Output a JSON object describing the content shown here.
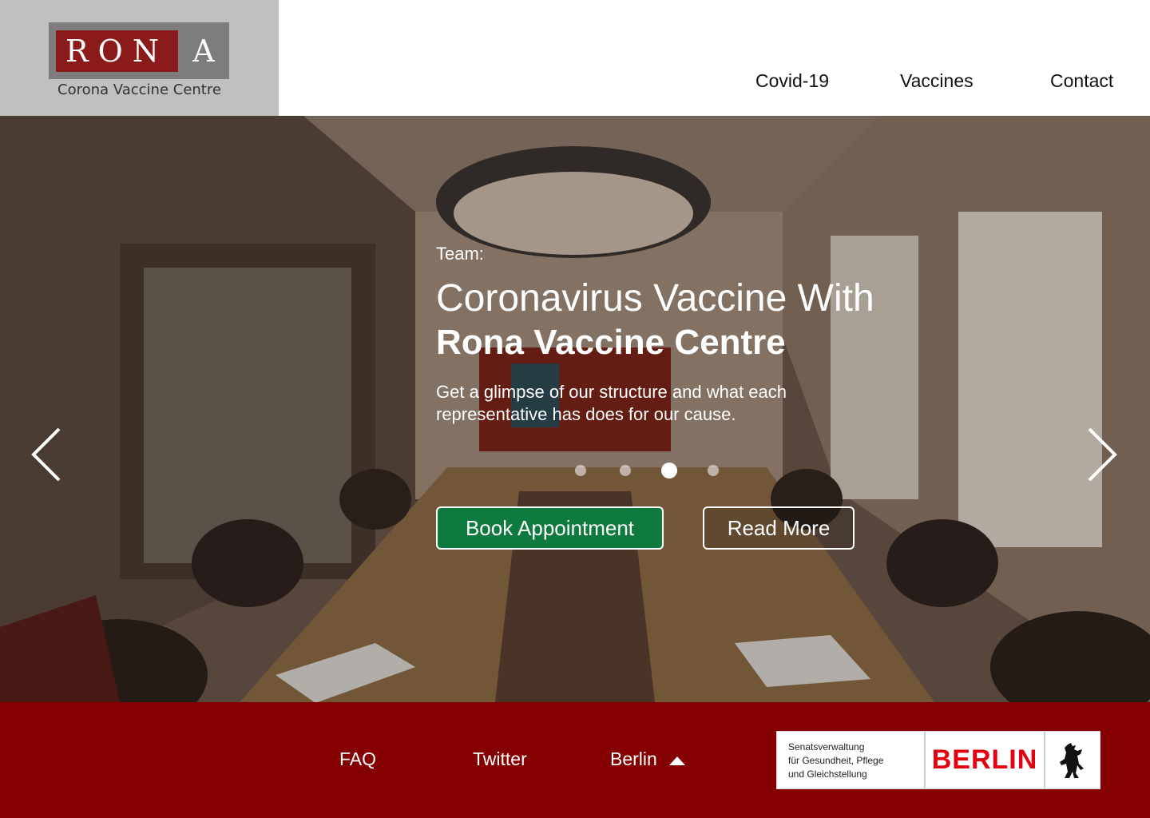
{
  "logo": {
    "letters_boxed": "RON",
    "letter_plain": "A",
    "subtitle": "Corona Vaccine Centre"
  },
  "nav": {
    "items": [
      "Covid-19",
      "Vaccines",
      "Contact"
    ]
  },
  "hero": {
    "eyebrow": "Team:",
    "headline_light": "Coronavirus Vaccine With",
    "headline_bold": "Rona Vaccine Centre",
    "description": "Get a glimpse of our structure and what each representative has does for our cause.",
    "primary_button": "Book Appointment",
    "secondary_button": "Read More",
    "carousel": {
      "slide_count": 4,
      "active_index": 2
    }
  },
  "footer": {
    "links": [
      "FAQ",
      "Twitter",
      "Berlin"
    ],
    "badge": {
      "text_line1": "Senatsverwaltung",
      "text_line2": "für Gesundheit, Pflege",
      "text_line3": "und Gleichstellung",
      "city": "BERLIN"
    }
  },
  "colors": {
    "brand_red": "#8b1a1a",
    "footer_red": "#850000",
    "button_green": "#0f7a3d",
    "logo_gray": "#c0c0c0"
  },
  "icons": {
    "prev": "chevron-left-icon",
    "next": "chevron-right-icon",
    "dropdown": "caret-up-icon",
    "bear": "berlin-bear-icon"
  }
}
